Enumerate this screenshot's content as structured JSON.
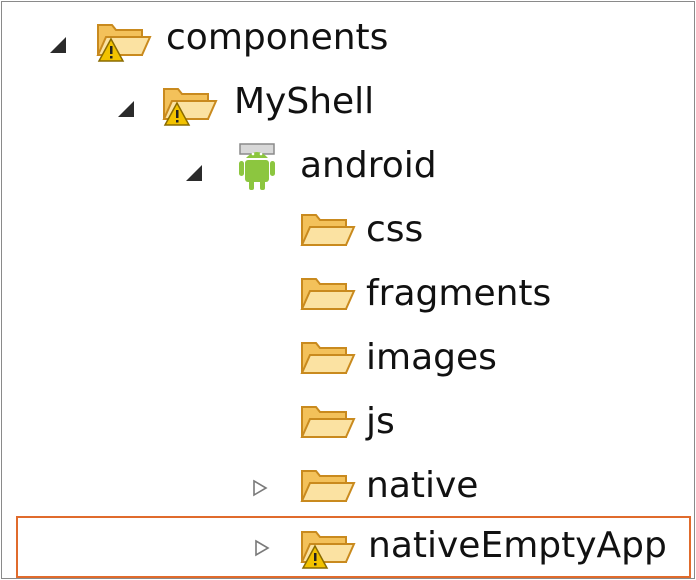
{
  "tree": {
    "items": [
      {
        "label": "components",
        "expanded": true,
        "icon": "warning-folder-icon"
      },
      {
        "label": "MyShell",
        "expanded": true,
        "icon": "warning-folder-icon"
      },
      {
        "label": "android",
        "expanded": true,
        "icon": "android-icon"
      },
      {
        "label": "css",
        "icon": "folder-icon"
      },
      {
        "label": "fragments",
        "icon": "folder-icon"
      },
      {
        "label": "images",
        "icon": "folder-icon"
      },
      {
        "label": "js",
        "icon": "folder-icon"
      },
      {
        "label": "native",
        "expanded": false,
        "icon": "folder-icon"
      },
      {
        "label": "nativeEmptyApp",
        "expanded": false,
        "icon": "warning-folder-icon",
        "selected": true
      }
    ]
  },
  "colors": {
    "folder": "#f3c15a",
    "folder_edge": "#c98a1e",
    "selection_border": "#e06b2c",
    "android": "#8cc63f",
    "warning": "#f2c200"
  }
}
